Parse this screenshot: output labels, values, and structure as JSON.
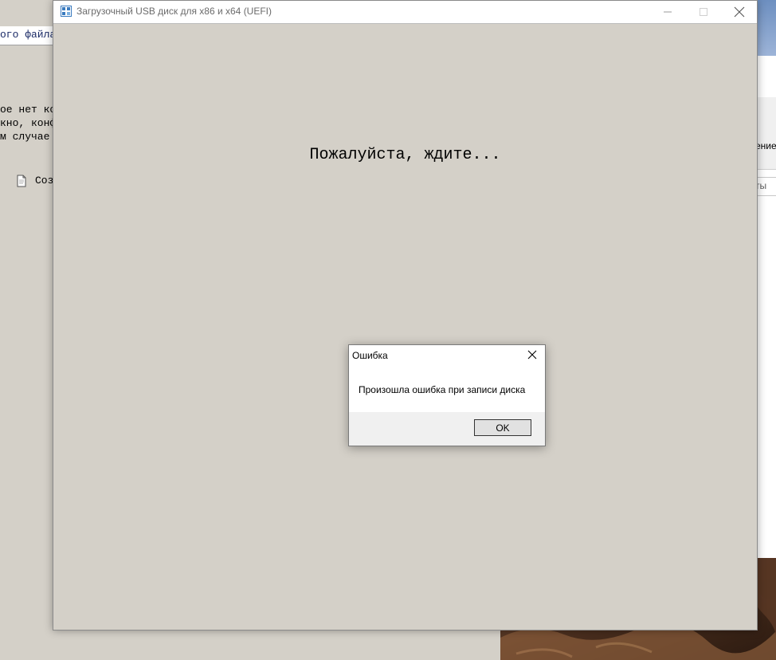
{
  "background_app": {
    "field_text": "ого файла",
    "lines": [
      "ое нет ко",
      "кно, конф",
      "м случае"
    ],
    "doc_item_label": "Соз"
  },
  "background_right": {
    "label1": "ение",
    "label2": "ты"
  },
  "main_window": {
    "title": "Загрузочный USB диск для x86 и x64 (UEFI)",
    "wait_message": "Пожалуйста, ждите..."
  },
  "error_dialog": {
    "title": "Ошибка",
    "message": "Произошла ошибка при записи диска",
    "ok_label": "OK"
  },
  "colors": {
    "window_bg": "#d4d0c8",
    "titlebar_bg": "#ffffff",
    "dialog_footer": "#f0f0f0"
  }
}
